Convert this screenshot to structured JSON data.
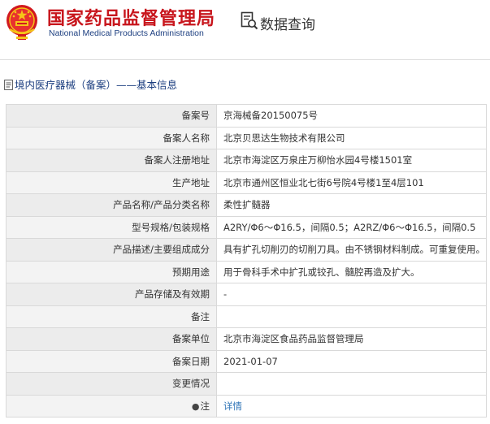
{
  "header": {
    "brand_cn": "国家药品监督管理局",
    "brand_en": "National Medical Products Administration",
    "query_label": "数据查询"
  },
  "section": {
    "title": "境内医疗器械（备案）——基本信息"
  },
  "rows": [
    {
      "label": "备案号",
      "value": "京海械备20150075号"
    },
    {
      "label": "备案人名称",
      "value": "北京贝思达生物技术有限公司"
    },
    {
      "label": "备案人注册地址",
      "value": "北京市海淀区万泉庄万柳怡水园4号楼1501室"
    },
    {
      "label": "生产地址",
      "value": "北京市通州区恒业北七街6号院4号楼1至4层101"
    },
    {
      "label": "产品名称/产品分类名称",
      "value": "柔性扩髓器"
    },
    {
      "label": "型号规格/包装规格",
      "value": "A2RY/Φ6～Φ16.5，间隔0.5；A2RZ/Φ6～Φ16.5，间隔0.5"
    },
    {
      "label": "产品描述/主要组成成分",
      "value": "具有扩孔切削刃的切削刀具。由不锈钢材料制成。可重复使用。"
    },
    {
      "label": "预期用途",
      "value": "用于骨科手术中扩孔或铰孔、髓腔再造及扩大。"
    },
    {
      "label": "产品存储及有效期",
      "value": "-"
    },
    {
      "label": "备注",
      "value": ""
    },
    {
      "label": "备案单位",
      "value": "北京市海淀区食品药品监督管理局"
    },
    {
      "label": "备案日期",
      "value": "2021-01-07"
    },
    {
      "label": "变更情况",
      "value": ""
    },
    {
      "label": "注",
      "value": "详情"
    }
  ],
  "colors": {
    "brand_red": "#c8161d",
    "brand_blue": "#1d3f80",
    "link": "#2d73b6"
  },
  "icons": {
    "emblem": "national-emblem-icon",
    "query": "search-document-icon",
    "note": "pin-icon"
  }
}
